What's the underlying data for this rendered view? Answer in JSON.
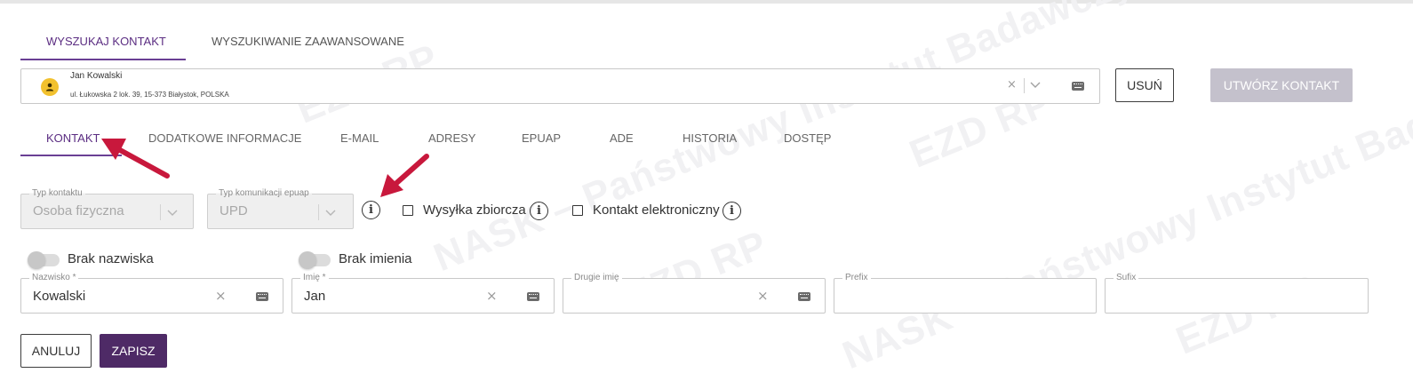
{
  "top_tabs": [
    {
      "label": "WYSZUKAJ KONTAKT",
      "active": true
    },
    {
      "label": "WYSZUKIWANIE ZAAWANSOWANE",
      "active": false
    }
  ],
  "search": {
    "name": "Jan Kowalski",
    "address": "ul. Łukowska 2 lok. 39, 15-373 Białystok, POLSKA",
    "clear_icon": "close-icon",
    "dropdown_icon": "chevron-down-icon",
    "keyboard_icon": "keyboard-icon"
  },
  "buttons": {
    "delete": "USUŃ",
    "create": "UTWÓRZ KONTAKT",
    "cancel": "ANULUJ",
    "save": "ZAPISZ"
  },
  "section_tabs": [
    {
      "label": "KONTAKT",
      "active": true
    },
    {
      "label": "DODATKOWE INFORMACJE",
      "active": false
    },
    {
      "label": "E-MAIL",
      "active": false
    },
    {
      "label": "ADRESY",
      "active": false
    },
    {
      "label": "EPUAP",
      "active": false
    },
    {
      "label": "ADE",
      "active": false
    },
    {
      "label": "HISTORIA",
      "active": false
    },
    {
      "label": "DOSTĘP",
      "active": false
    }
  ],
  "form": {
    "contact_type": {
      "label": "Typ kontaktu",
      "value": "Osoba fizyczna"
    },
    "epuap_type": {
      "label": "Typ komunikacji epuap",
      "value": "UPD"
    },
    "bulk_mailing": {
      "label": "Wysyłka zbiorcza",
      "checked": false
    },
    "electronic_contact": {
      "label": "Kontakt elektroniczny",
      "checked": false
    },
    "no_surname": {
      "label": "Brak nazwiska",
      "on": false
    },
    "no_first_name": {
      "label": "Brak imienia",
      "on": false
    },
    "surname": {
      "label": "Nazwisko *",
      "value": "Kowalski"
    },
    "first_name": {
      "label": "Imię *",
      "value": "Jan"
    },
    "second_name": {
      "label": "Drugie imię",
      "value": ""
    },
    "prefix": {
      "label": "Prefix",
      "value": ""
    },
    "suffix": {
      "label": "Sufix",
      "value": ""
    }
  },
  "clear_glyph": "×",
  "info_glyph": "i",
  "watermark": "NASK – Państwowy Instytut Badawczy",
  "watermark_logo": "EZD RP",
  "colors": {
    "accent": "#5b2d82",
    "primary_button": "#4e2a66",
    "disabled_button": "#c4c1cc",
    "avatar": "#f2c12e",
    "annotation_arrow": "#c8183c"
  }
}
